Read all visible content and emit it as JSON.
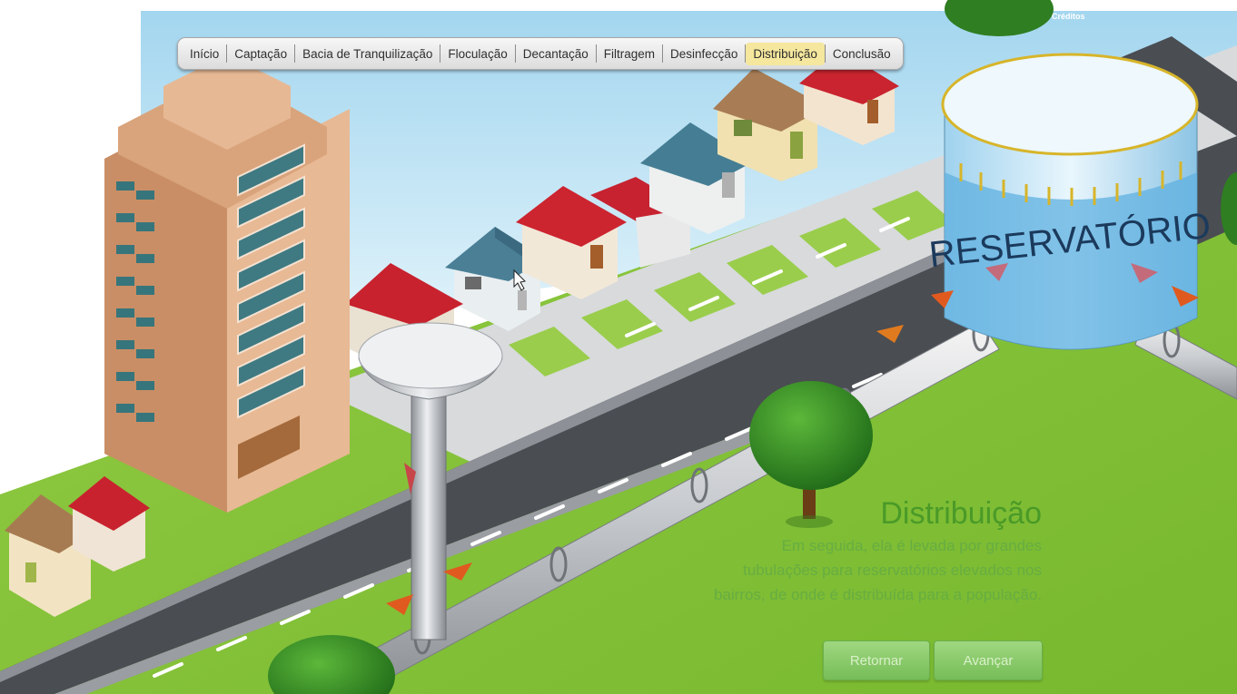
{
  "nav": {
    "items": [
      {
        "label": "Início"
      },
      {
        "label": "Captação"
      },
      {
        "label": "Bacia de Tranquilização"
      },
      {
        "label": "Floculação"
      },
      {
        "label": "Decantação"
      },
      {
        "label": "Filtragem"
      },
      {
        "label": "Desinfecção"
      },
      {
        "label": "Distribuição",
        "active": true
      },
      {
        "label": "Conclusão"
      }
    ]
  },
  "credits_label": "Créditos",
  "scene": {
    "reservoir_label": "RESERVATÓRIO"
  },
  "info": {
    "title": "Distribuição",
    "text_lines": [
      "Em seguida, ela é levada por grandes",
      "tubulações para reservatórios elevados nos",
      "bairros, de onde é distribuída para a população."
    ]
  },
  "buttons": {
    "back_label": "Retornar",
    "next_label": "Avançar"
  },
  "colors": {
    "grass": "#8cc63f",
    "road": "#4a4d52",
    "sky": "#bde4f5",
    "active_tab": "#f5e79d",
    "info_title": "#4a9a28",
    "button": "#86c866"
  }
}
